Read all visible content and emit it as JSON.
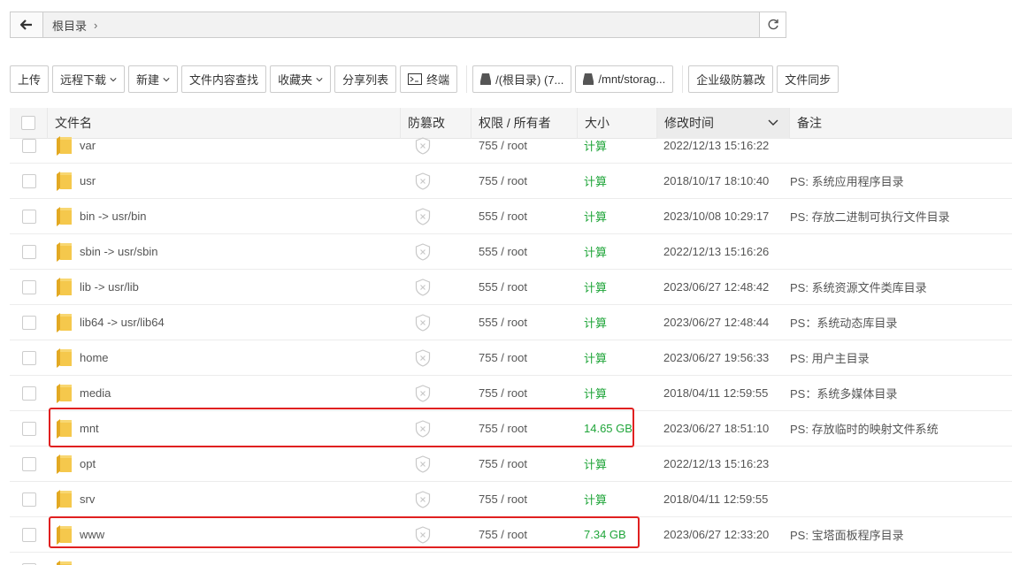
{
  "pathbar": {
    "crumb": "根目录",
    "crumb_sep": "›"
  },
  "toolbar": {
    "upload": "上传",
    "remote_download": "远程下载",
    "new": "新建",
    "content_search": "文件内容查找",
    "favorites": "收藏夹",
    "share_list": "分享列表",
    "terminal": "终端",
    "disk_root": "/(根目录) (7...",
    "disk_mnt": "/mnt/storag...",
    "enterprise_tamper": "企业级防篡改",
    "file_sync": "文件同步"
  },
  "table": {
    "headers": {
      "name": "文件名",
      "tamper": "防篡改",
      "perm": "权限 / 所有者",
      "size": "大小",
      "mtime": "修改时间",
      "note": "备注"
    },
    "rows": [
      {
        "name": "var",
        "perm": "755 / root",
        "size": "计算",
        "mtime": "2022/12/13 15:16:22",
        "note": ""
      },
      {
        "name": "usr",
        "perm": "755 / root",
        "size": "计算",
        "mtime": "2018/10/17 18:10:40",
        "note": "PS: 系统应用程序目录"
      },
      {
        "name": "bin -> usr/bin",
        "perm": "555 / root",
        "size": "计算",
        "mtime": "2023/10/08 10:29:17",
        "note": "PS: 存放二进制可执行文件目录"
      },
      {
        "name": "sbin -> usr/sbin",
        "perm": "555 / root",
        "size": "计算",
        "mtime": "2022/12/13 15:16:26",
        "note": ""
      },
      {
        "name": "lib -> usr/lib",
        "perm": "555 / root",
        "size": "计算",
        "mtime": "2023/06/27 12:48:42",
        "note": "PS: 系统资源文件类库目录"
      },
      {
        "name": "lib64 -> usr/lib64",
        "perm": "555 / root",
        "size": "计算",
        "mtime": "2023/06/27 12:48:44",
        "note": "PS：系统动态库目录"
      },
      {
        "name": "home",
        "perm": "755 / root",
        "size": "计算",
        "mtime": "2023/06/27 19:56:33",
        "note": "PS: 用户主目录"
      },
      {
        "name": "media",
        "perm": "755 / root",
        "size": "计算",
        "mtime": "2018/04/11 12:59:55",
        "note": "PS：系统多媒体目录"
      },
      {
        "name": "mnt",
        "perm": "755 / root",
        "size": "14.65 GB",
        "mtime": "2023/06/27 18:51:10",
        "note": "PS: 存放临时的映射文件系统"
      },
      {
        "name": "opt",
        "perm": "755 / root",
        "size": "计算",
        "mtime": "2022/12/13 15:16:23",
        "note": ""
      },
      {
        "name": "srv",
        "perm": "755 / root",
        "size": "计算",
        "mtime": "2018/04/11 12:59:55",
        "note": ""
      },
      {
        "name": "www",
        "perm": "755 / root",
        "size": "7.34 GB",
        "mtime": "2023/06/27 12:33:20",
        "note": "PS: 宝塔面板程序目录"
      },
      {
        "name": "",
        "perm": "",
        "size": "",
        "mtime": "",
        "note": ""
      }
    ]
  },
  "colors": {
    "size_green": "#20a53a",
    "highlight_red": "#e02020",
    "folder_yellow": "#f5c84c"
  }
}
